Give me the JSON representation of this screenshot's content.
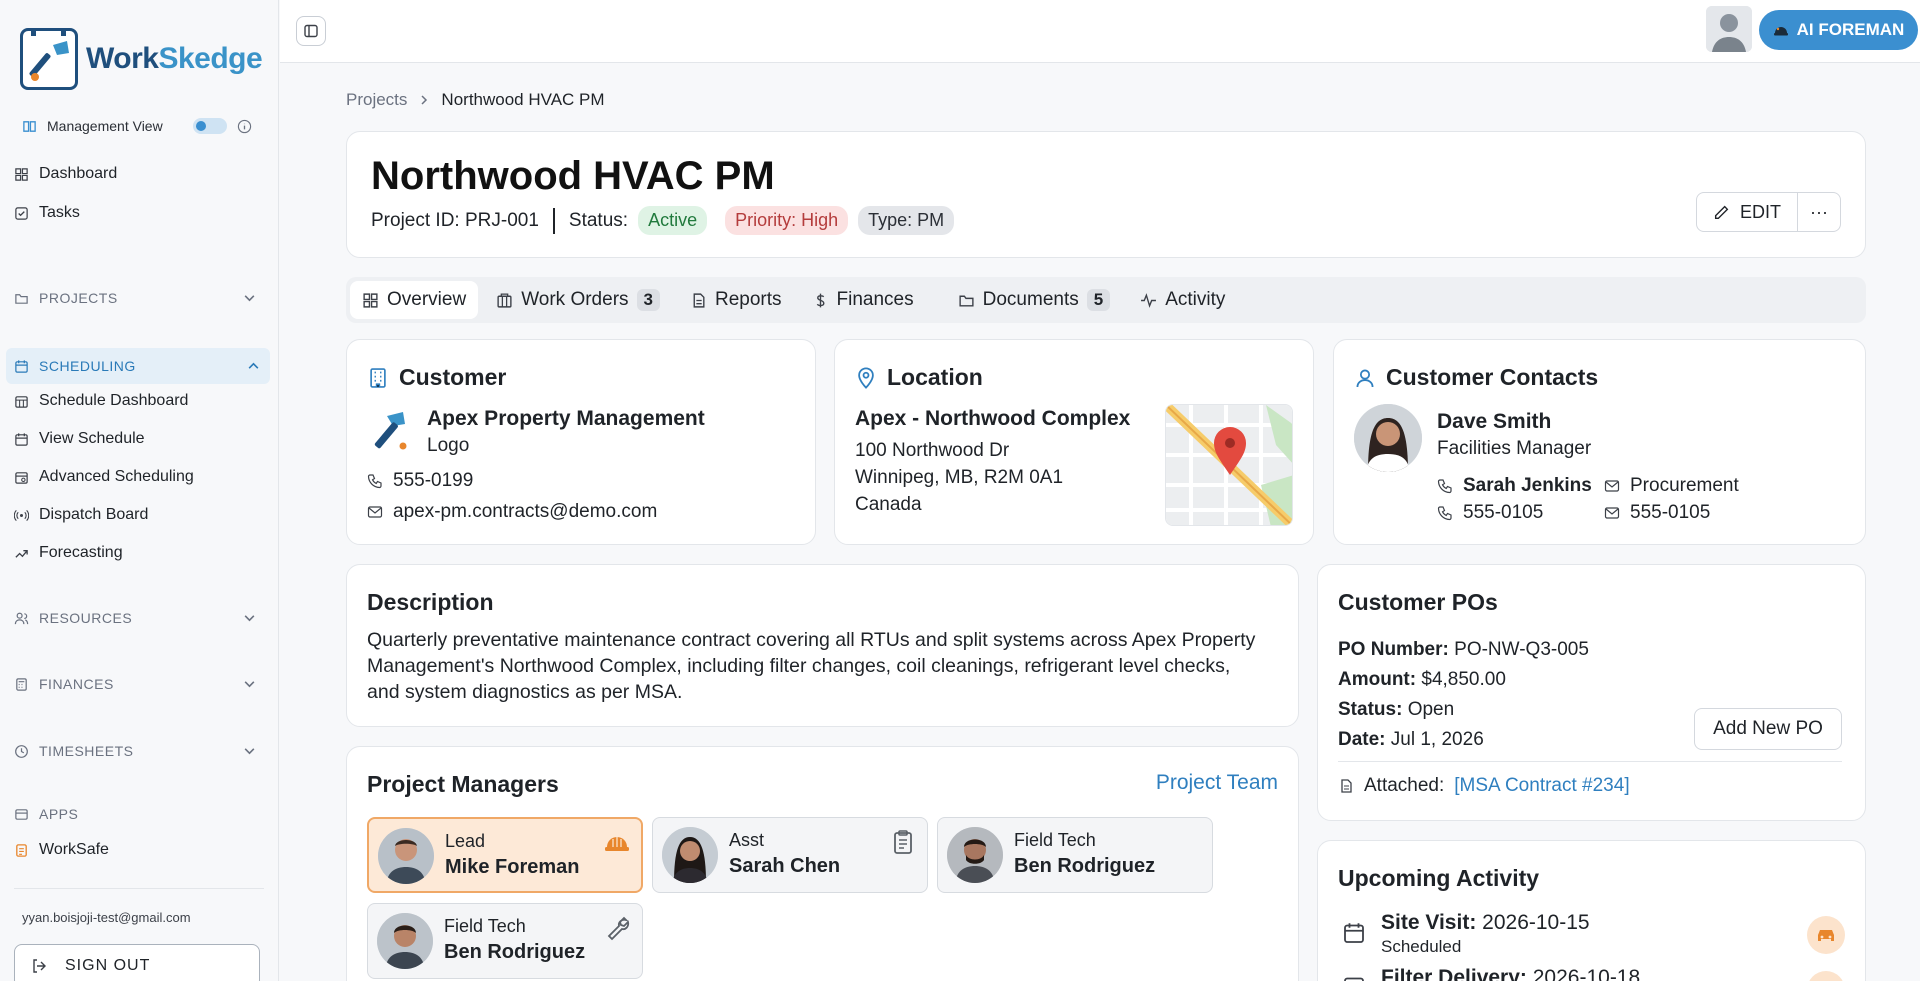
{
  "app": {
    "name_part1": "Work",
    "name_part2": "Skedge"
  },
  "sidebar": {
    "management_view": "Management View",
    "dashboard": "Dashboard",
    "tasks": "Tasks",
    "projects": "PROJECTS",
    "scheduling": "SCHEDULING",
    "scheduling_items": [
      "Schedule Dashboard",
      "View Schedule",
      "Advanced Scheduling",
      "Dispatch Board",
      "Forecasting"
    ],
    "resources": "RESOURCES",
    "finances": "FINANCES",
    "timesheets": "TIMESHEETS",
    "apps": "APPS",
    "worksafe": "WorkSafe",
    "email": "yyan.boisjoji-test@gmail.com",
    "sign_out": "SIGN OUT"
  },
  "topbar": {
    "ai_button": "AI FOREMAN"
  },
  "breadcrumb": {
    "root": "Projects",
    "current": "Northwood HVAC PM"
  },
  "project": {
    "title": "Northwood HVAC PM",
    "id_text": "Project ID: PRJ-001",
    "status_label": "Status:",
    "status": "Active",
    "priority": "Priority: High",
    "type": "Type: PM",
    "edit_label": "EDIT",
    "more_label": "···"
  },
  "tabs": [
    {
      "label": "Overview"
    },
    {
      "label": "Work Orders",
      "count": "3"
    },
    {
      "label": "Reports"
    },
    {
      "label": "Finances"
    },
    {
      "label": "Documents",
      "count": "5"
    },
    {
      "label": "Activity"
    }
  ],
  "customer": {
    "title": "Customer",
    "name": "Apex Property Management",
    "logo_label": "Logo",
    "phone": "555-0199",
    "email": "apex-pm.contracts@demo.com"
  },
  "location": {
    "title": "Location",
    "name": "Apex - Northwood Complex",
    "line1": "100 Northwood Dr",
    "line2": "Winnipeg, MB, R2M 0A1",
    "line3": "Canada"
  },
  "contacts": {
    "title": "Customer Contacts",
    "primary_name": "Dave Smith",
    "primary_role": "Facilities Manager",
    "secondary_name": "Sarah Jenkins",
    "secondary_role": "Procurement",
    "phone1": "555-0105",
    "phone2": "555-0105"
  },
  "description": {
    "title": "Description",
    "text": "Quarterly preventative maintenance contract covering all RTUs and split systems across Apex Property Management's Northwood Complex, including filter changes, coil cleanings, refrigerant level checks, and system diagnostics as per MSA."
  },
  "pos": {
    "title": "Customer POs",
    "po_label": "PO Number:",
    "po_value": "PO-NW-Q3-005",
    "amount_label": "Amount:",
    "amount_value": "$4,850.00",
    "status_label": "Status:",
    "status_value": "Open",
    "date_label": "Date:",
    "date_value": "Jul 1, 2026",
    "add_button": "Add New PO",
    "attached_label": "Attached:",
    "attached_link": "[MSA Contract #234]"
  },
  "managers": {
    "title": "Project Managers",
    "team_link": "Project Team",
    "people": [
      {
        "role": "Lead",
        "name": "Mike Foreman"
      },
      {
        "role": "Asst",
        "name": "Sarah Chen"
      },
      {
        "role": "Field Tech",
        "name": "Ben Rodriguez"
      },
      {
        "role": "Field Tech",
        "name": "Ben Rodriguez"
      }
    ]
  },
  "activity": {
    "title": "Upcoming Activity",
    "item1_label": "Site Visit:",
    "item1_date": "2026-10-15",
    "item1_status": "Scheduled",
    "item2_label": "Filter Delivery:",
    "item2_date": "2026-10-18"
  },
  "colors": {
    "accent": "#3b8fd0",
    "brand": "#1f4f7d",
    "lead_bg": "#fde9d7"
  }
}
